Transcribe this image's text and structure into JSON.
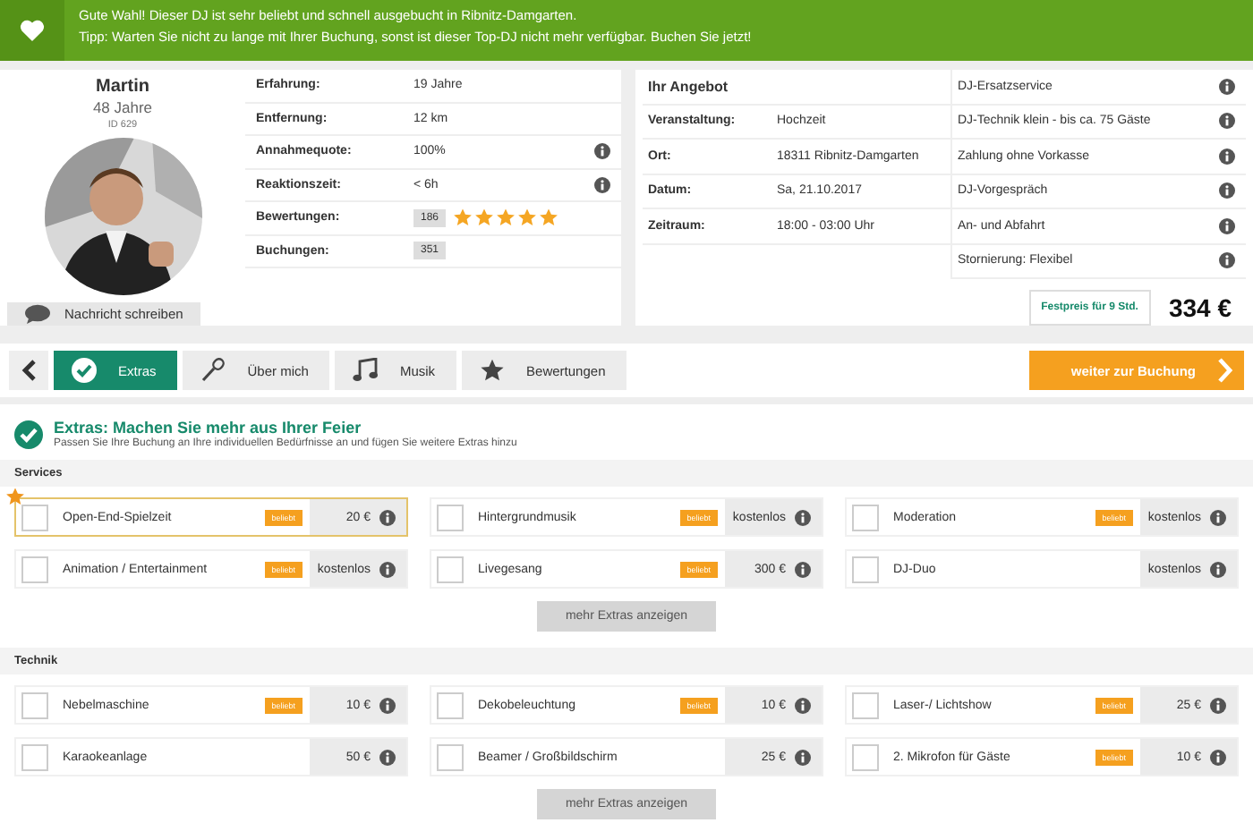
{
  "banner": {
    "lines": [
      "Gute Wahl! Dieser DJ ist sehr beliebt und schnell ausgebucht in Ribnitz-Damgarten.",
      "Tipp: Warten Sie nicht zu lange mit Ihrer Buchung, sonst ist dieser Top-DJ nicht mehr verfügbar. Buchen Sie jetzt!"
    ]
  },
  "profile": {
    "name": "Martin",
    "age": "48 Jahre",
    "id": "ID 629",
    "message_button": "Nachricht schreiben"
  },
  "stats": [
    {
      "kind": "text",
      "label": "Erfahrung:",
      "value": "19 Jahre",
      "info": false
    },
    {
      "kind": "text",
      "label": "Entfernung:",
      "value": "12 km",
      "info": false
    },
    {
      "kind": "text",
      "label": "Annahmequote:",
      "value": "100%",
      "info": true
    },
    {
      "kind": "text",
      "label": "Reaktionszeit:",
      "value": "< 6h",
      "info": true
    },
    {
      "kind": "rating",
      "label": "Bewertungen:",
      "value": "186",
      "stars": 5,
      "info": false
    },
    {
      "kind": "count",
      "label": "Buchungen:",
      "value": "351",
      "info": false
    }
  ],
  "offer": {
    "title": "Ihr Angebot",
    "details": [
      {
        "label": "Veranstaltung:",
        "value": "Hochzeit"
      },
      {
        "label": "Ort:",
        "value": "18311 Ribnitz-Damgarten"
      },
      {
        "label": "Datum:",
        "value": "Sa, 21.10.2017"
      },
      {
        "label": "Zeitraum:",
        "value": "18:00 - 03:00 Uhr"
      }
    ],
    "features": [
      "DJ-Ersatzservice",
      "DJ-Technik klein - bis ca. 75 Gäste",
      "Zahlung ohne Vorkasse",
      "DJ-Vorgespräch",
      "An- und Abfahrt",
      "Stornierung: Flexibel"
    ],
    "price_label": "Festpreis für 9 Std.",
    "price": "334 €"
  },
  "nav": {
    "tabs": [
      {
        "label": "Extras",
        "kind": "check",
        "selected": true
      },
      {
        "label": "Über mich",
        "kind": "microphone",
        "selected": false
      },
      {
        "label": "Musik",
        "kind": "note",
        "selected": false
      },
      {
        "label": "Bewertungen",
        "kind": "star",
        "selected": false
      }
    ],
    "next_button": "weiter zur Buchung"
  },
  "extras": {
    "title": "Extras: Machen Sie mehr aus Ihrer Feier",
    "subtitle": "Passen Sie Ihre Buchung an Ihre individuellen Bedürfnisse an und fügen Sie weitere Extras hinzu",
    "groups": [
      {
        "name": "Services",
        "more_button": "mehr Extras anzeigen",
        "items": [
          {
            "name": "Open-End-Spielzeit",
            "badge": "beliebt",
            "price": "20 €",
            "checked": false,
            "featured": true
          },
          {
            "name": "Hintergrundmusik",
            "badge": "beliebt",
            "price": "kostenlos",
            "checked": false,
            "featured": false
          },
          {
            "name": "Moderation",
            "badge": "beliebt",
            "price": "kostenlos",
            "checked": false,
            "featured": false
          },
          {
            "name": "Animation / Entertainment",
            "badge": "beliebt",
            "price": "kostenlos",
            "checked": false,
            "featured": false
          },
          {
            "name": "Livegesang",
            "badge": "beliebt",
            "price": "300 €",
            "checked": false,
            "featured": false
          },
          {
            "name": "DJ-Duo",
            "price": "kostenlos",
            "checked": false,
            "featured": false
          }
        ]
      },
      {
        "name": "Technik",
        "more_button": "mehr Extras anzeigen",
        "items": [
          {
            "name": "Nebelmaschine",
            "badge": "beliebt",
            "price": "10 €",
            "checked": false,
            "featured": false
          },
          {
            "name": "Dekobeleuchtung",
            "badge": "beliebt",
            "price": "10 €",
            "checked": false,
            "featured": false
          },
          {
            "name": "Laser-/ Lichtshow",
            "badge": "beliebt",
            "price": "25 €",
            "checked": false,
            "featured": false
          },
          {
            "name": "Karaokeanlage",
            "price": "50 €",
            "checked": false,
            "featured": false
          },
          {
            "name": "Beamer / Großbildschirm",
            "price": "25 €",
            "checked": false,
            "featured": false
          },
          {
            "name": "2. Mikrofon für Gäste",
            "badge": "beliebt",
            "price": "10 €",
            "checked": false,
            "featured": false
          }
        ]
      }
    ]
  }
}
